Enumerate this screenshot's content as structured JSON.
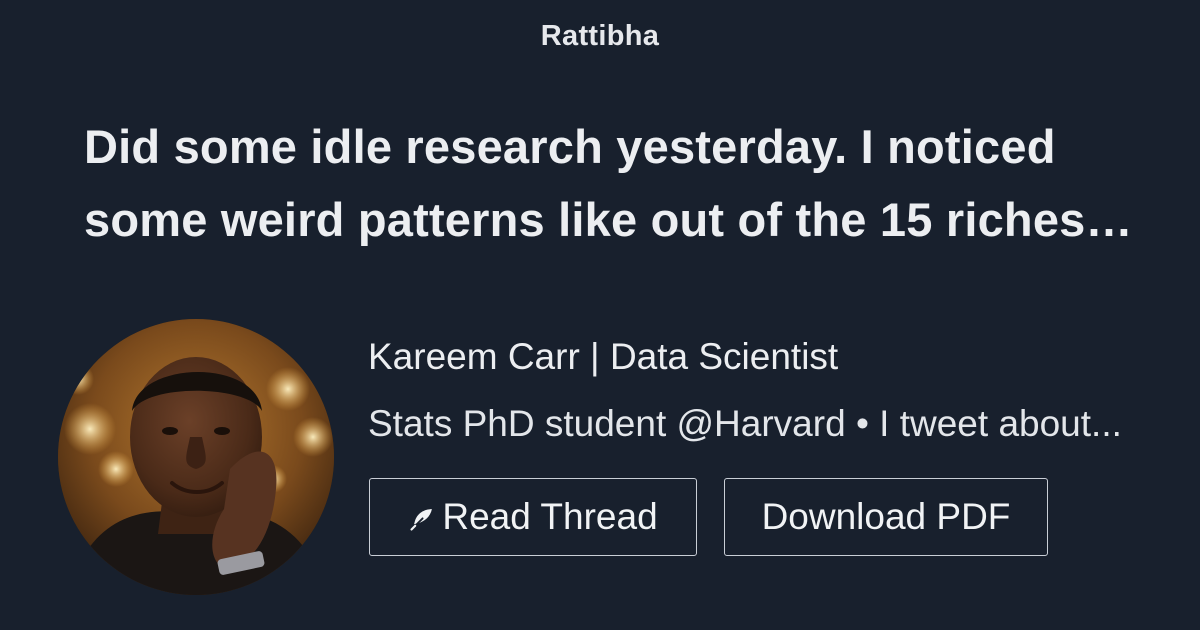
{
  "site": {
    "brand": "Rattibha"
  },
  "thread": {
    "headline": "Did some idle research yesterday. I noticed some weird patterns like out of the 15 riches…"
  },
  "author": {
    "name": "Kareem Carr | Data Scientist",
    "bio": "Stats PhD student @Harvard • I tweet about...",
    "avatar_icon": "avatar-photo"
  },
  "actions": {
    "read_label": "Read Thread",
    "read_icon": "feather-icon",
    "pdf_label": "Download PDF"
  },
  "colors": {
    "background": "#18202d",
    "text": "#eceef1",
    "button_border": "#c9ced6"
  }
}
